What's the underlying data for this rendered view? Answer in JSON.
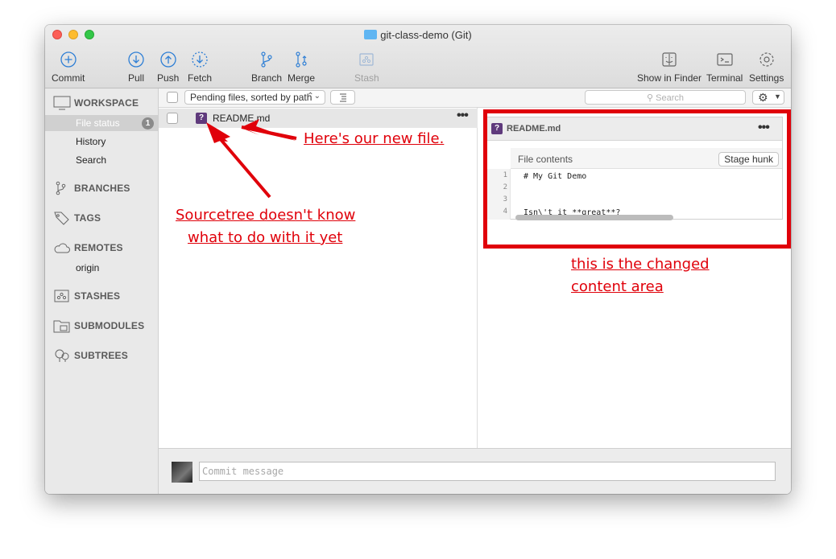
{
  "window": {
    "title": "git-class-demo (Git)"
  },
  "toolbar": {
    "commit": "Commit",
    "pull": "Pull",
    "push": "Push",
    "fetch": "Fetch",
    "branch": "Branch",
    "merge": "Merge",
    "stash": "Stash",
    "show_in_finder": "Show in Finder",
    "terminal": "Terminal",
    "settings": "Settings"
  },
  "sidebar": {
    "workspace": "WORKSPACE",
    "file_status": "File status",
    "file_status_count": "1",
    "history": "History",
    "search": "Search",
    "branches": "BRANCHES",
    "tags": "TAGS",
    "remotes": "REMOTES",
    "remote_origin": "origin",
    "stashes": "STASHES",
    "submodules": "SUBMODULES",
    "subtrees": "SUBTREES"
  },
  "filterbar": {
    "sort": "Pending files, sorted by path",
    "search_placeholder": "Search"
  },
  "files": [
    {
      "name": "README.md",
      "status": "?"
    }
  ],
  "diff": {
    "filename": "README.md",
    "hunk_title": "File contents",
    "stage_hunk": "Stage hunk",
    "lines": [
      {
        "num": "1",
        "text": "# My Git Demo"
      },
      {
        "num": "2",
        "text": ""
      },
      {
        "num": "3",
        "text": ""
      },
      {
        "num": "4",
        "text": "Isn\\'t it **great**?"
      }
    ]
  },
  "commit": {
    "placeholder": "Commit message"
  },
  "annotations": {
    "new_file": "Here's our new file.",
    "unknown_line1": "Sourcetree doesn't know",
    "unknown_line2": "what to do with it yet",
    "changed_line1": "this is the changed",
    "changed_line2": "content area"
  },
  "colors": {
    "annotation_red": "#e0000a",
    "file_status_icon": "#5f3a7c"
  }
}
